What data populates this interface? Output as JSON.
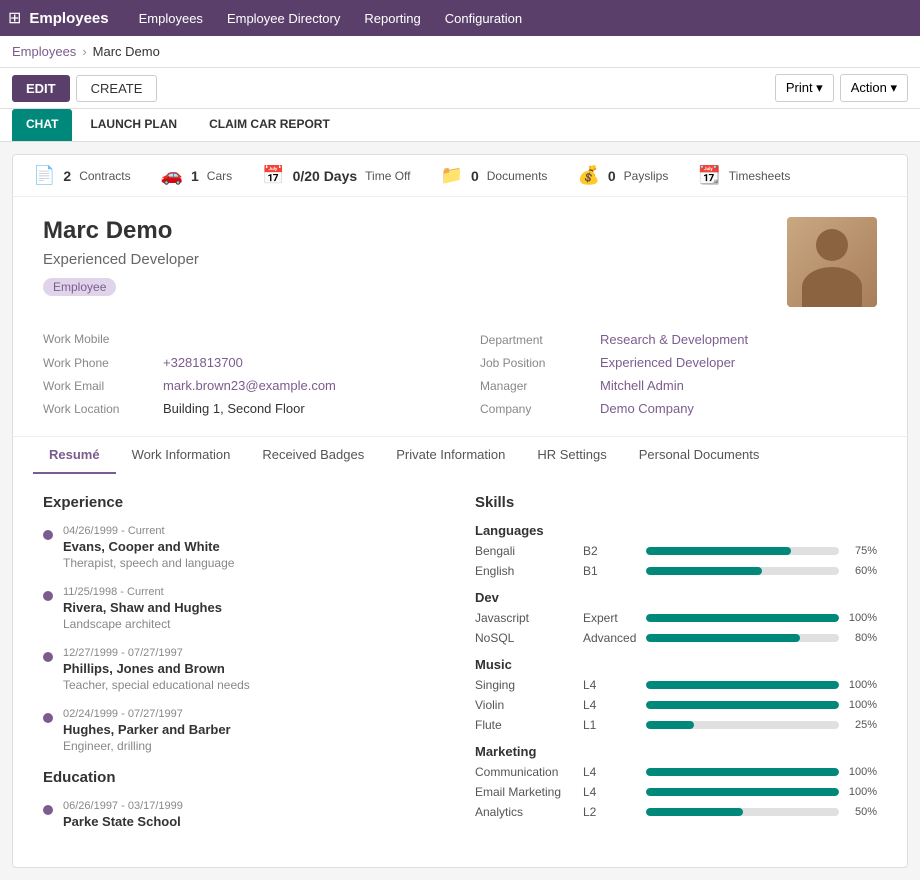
{
  "app": {
    "title": "Employees",
    "nav_links": [
      "Employees",
      "Employee Directory",
      "Reporting",
      "Configuration"
    ]
  },
  "breadcrumb": {
    "parent": "Employees",
    "current": "Marc Demo"
  },
  "toolbar": {
    "edit_label": "EDIT",
    "create_label": "CREATE",
    "print_label": "Print ▾",
    "action_label": "Action ▾"
  },
  "tab_bar": {
    "tabs": [
      "CHAT",
      "LAUNCH PLAN",
      "CLAIM CAR REPORT"
    ],
    "active": "CHAT"
  },
  "stats": [
    {
      "icon": "📄",
      "count": "2",
      "label": "Contracts"
    },
    {
      "icon": "🚗",
      "count": "1",
      "label": "Cars"
    },
    {
      "icon": "📅",
      "count": "0/20 Days",
      "label": "Time Off"
    },
    {
      "icon": "📁",
      "count": "0",
      "label": "Documents"
    },
    {
      "icon": "💰",
      "count": "0",
      "label": "Payslips"
    },
    {
      "icon": "📆",
      "count": "",
      "label": "Timesheets"
    }
  ],
  "employee": {
    "name": "Marc Demo",
    "title": "Experienced Developer",
    "badge": "Employee",
    "work_mobile_label": "Work Mobile",
    "work_mobile_value": "",
    "work_phone_label": "Work Phone",
    "work_phone_value": "+3281813700",
    "work_email_label": "Work Email",
    "work_email_value": "mark.brown23@example.com",
    "work_location_label": "Work Location",
    "work_location_value": "Building 1, Second Floor",
    "company_label": "Company",
    "company_value": "Demo Company",
    "department_label": "Department",
    "department_value": "Research & Development",
    "job_position_label": "Job Position",
    "job_position_value": "Experienced Developer",
    "manager_label": "Manager",
    "manager_value": "Mitchell Admin"
  },
  "inner_tabs": [
    "Resumé",
    "Work Information",
    "Received Badges",
    "Private Information",
    "HR Settings",
    "Personal Documents"
  ],
  "active_inner_tab": "Resumé",
  "experience": {
    "title": "Experience",
    "items": [
      {
        "dates": "04/26/1999 - Current",
        "company": "Evans, Cooper and White",
        "role": "Therapist, speech and language"
      },
      {
        "dates": "11/25/1998 - Current",
        "company": "Rivera, Shaw and Hughes",
        "role": "Landscape architect"
      },
      {
        "dates": "12/27/1999 - 07/27/1997",
        "company": "Phillips, Jones and Brown",
        "role": "Teacher, special educational needs"
      },
      {
        "dates": "02/24/1999 - 07/27/1997",
        "company": "Hughes, Parker and Barber",
        "role": "Engineer, drilling"
      }
    ]
  },
  "education": {
    "title": "Education",
    "items": [
      {
        "dates": "06/26/1997 - 03/17/1999",
        "school": "Parke State School",
        "field": ""
      }
    ]
  },
  "skills": {
    "title": "Skills",
    "categories": [
      {
        "name": "Languages",
        "items": [
          {
            "name": "Bengali",
            "level": "B2",
            "pct": 75
          },
          {
            "name": "English",
            "level": "B1",
            "pct": 60
          }
        ]
      },
      {
        "name": "Dev",
        "items": [
          {
            "name": "Javascript",
            "level": "Expert",
            "pct": 100
          },
          {
            "name": "NoSQL",
            "level": "Advanced",
            "pct": 80
          }
        ]
      },
      {
        "name": "Music",
        "items": [
          {
            "name": "Singing",
            "level": "L4",
            "pct": 100
          },
          {
            "name": "Violin",
            "level": "L4",
            "pct": 100
          },
          {
            "name": "Flute",
            "level": "L1",
            "pct": 25
          }
        ]
      },
      {
        "name": "Marketing",
        "items": [
          {
            "name": "Communication",
            "level": "L4",
            "pct": 100
          },
          {
            "name": "Email Marketing",
            "level": "L4",
            "pct": 100
          },
          {
            "name": "Analytics",
            "level": "L2",
            "pct": 50
          }
        ]
      }
    ]
  }
}
